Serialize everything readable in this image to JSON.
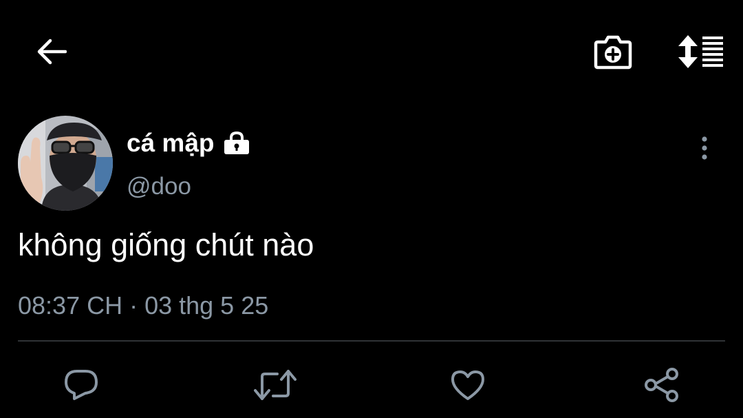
{
  "header": {
    "back_icon": "arrow-left-icon",
    "camera_icon": "camera-plus-icon",
    "sort_icon": "sort-list-icon"
  },
  "tweet": {
    "display_name": "cá mập",
    "handle": "@doo",
    "protected_icon": "lock-icon",
    "text": "không giống chút nào",
    "timestamp": "08:37 CH · 03 thg 5 25",
    "more_icon": "more-vertical-icon"
  },
  "actions": {
    "reply_icon": "reply-icon",
    "retweet_icon": "retweet-icon",
    "like_icon": "heart-icon",
    "share_icon": "share-icon"
  },
  "colors": {
    "background": "#000000",
    "text_primary": "#ffffff",
    "text_secondary": "#8b98a5",
    "divider": "#2f3336"
  }
}
